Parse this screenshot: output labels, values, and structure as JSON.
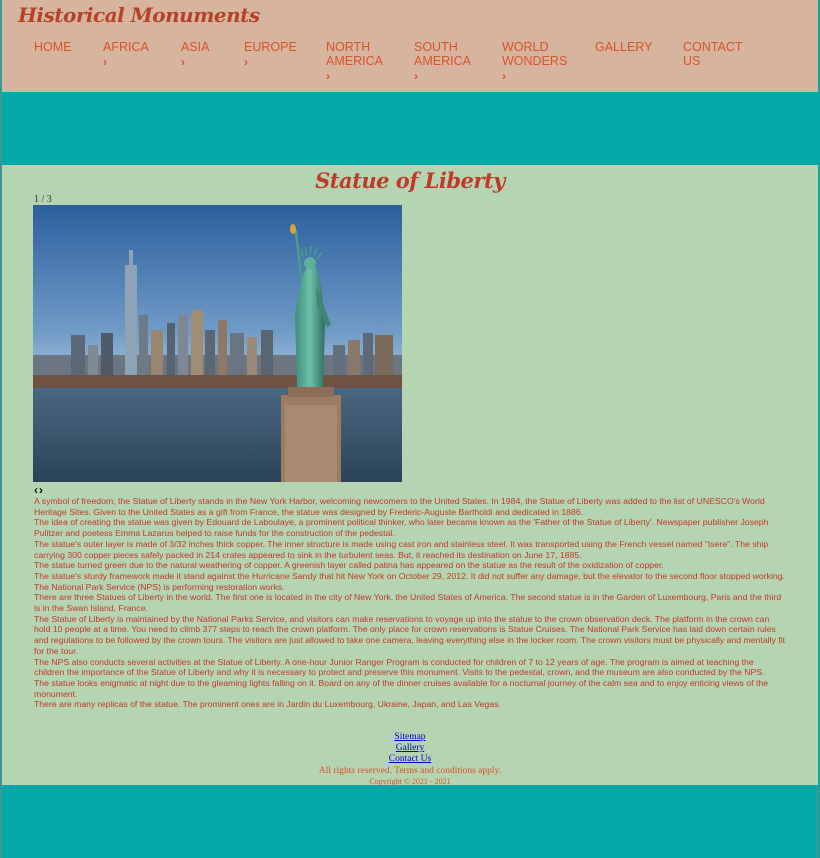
{
  "header": {
    "brand": "Historical Monuments",
    "nav": [
      {
        "label": "HOME",
        "has_submenu": false
      },
      {
        "label": "AFRICA",
        "has_submenu": true
      },
      {
        "label": "ASIA",
        "has_submenu": true
      },
      {
        "label": "EUROPE",
        "has_submenu": true
      },
      {
        "label": "NORTH AMERICA",
        "has_submenu": true
      },
      {
        "label": "SOUTH AMERICA",
        "has_submenu": true
      },
      {
        "label": "WORLD WONDERS",
        "has_submenu": true
      },
      {
        "label": "GALLERY",
        "has_submenu": false
      },
      {
        "label": "CONTACT US",
        "has_submenu": false
      }
    ],
    "chevron": "›"
  },
  "main": {
    "title": "Statue of Liberty",
    "slideshow": {
      "counter": "1 / 3",
      "prev": "‹",
      "next": "›"
    },
    "paragraphs": [
      "A symbol of freedom, the Statue of Liberty stands in the New York Harbor, welcoming newcomers to the United States. In 1984, the Statue of Liberty was added to the list of UNESCO's World Heritage Sites. Given to the United States as a gift from France, the statue was designed by Frederic-Auguste Bartholdi and dedicated in 1886.",
      "The idea of creating the statue was given by Edouard de Laboulaye, a prominent political thinker, who later became known as the 'Father of the Statue of Liberty'. Newspaper publisher Joseph Pulitzer and poetess Emma Lazarus helped to raise funds for the construction of the pedestal.",
      "The statue's outer layer is made of 3/32 inches thick copper. The inner structure is made using cast iron and stainless steel. It was transported using the French vessel named \"Isere\". The ship carrying 300 copper pieces safely packed in 214 crates appeared to sink in the turbulent seas. But, it reached its destination on June 17, 1885.",
      "The statue turned green due to the natural weathering of copper. A greenish layer called patina has appeared on the statue as the result of the oxidization of copper.",
      "The statue's sturdy framework made it stand against the Hurricane Sandy that hit New York on October 29, 2012. It did not suffer any damage, but the elevator to the second floor stopped working. The National Park Service (NPS) is performing restoration works.",
      "There are three Statues of Liberty in the world. The first one is located in the city of New York, the United States of America. The second statue is in the Garden of Luxembourg, Paris and the third is in the Swan Island, France.",
      "The Statue of Liberty is maintained by the National Parks Service, and visitors can make reservations to voyage up into the statue to the crown observation deck. The platform in the crown can hold 10 people at a time. You need to climb 377 steps to reach the crown platform. The only place for crown reservations is Statue Cruises. The National Park Service has laid down certain rules and regulations to be followed by the crown tours. The visitors are just allowed to take one camera, leaving everything else in the locker room. The crown visitors must be physically and mentally fit for the tour.",
      "The NPS also conducts several activities at the Statue of Liberty. A one-hour Junior Ranger Program is conducted for children of 7 to 12 years of age. The program is aimed at teaching the children the importance of the Statue of Liberty and why it is necessary to protect and preserve this monument. Visits to the pedestal, crown, and the museum are also conducted by the NPS.",
      "The statue looks enigmatic at night due to the gleaming lights falling on it. Board on any of the dinner cruises available for a nocturnal journey of the calm sea and to enjoy enticing views of the monument.",
      "There are many replicas of the statue. The prominent ones are in Jardin du Luxembourg, Ukraine, Japan, and Las Vegas."
    ]
  },
  "footer": {
    "links": [
      "Sitemap",
      "Gallery",
      "Contact Us"
    ],
    "rights": "All rights reserved. Terms and conditions apply.",
    "copyright": "Copyright © 2021 - 2021"
  },
  "colors": {
    "header_bg": "#d7b49e",
    "accent_teal": "#05a8a8",
    "content_bg": "#b5d4b2",
    "text_red": "#c2392b",
    "nav_orange": "#d9532b"
  }
}
